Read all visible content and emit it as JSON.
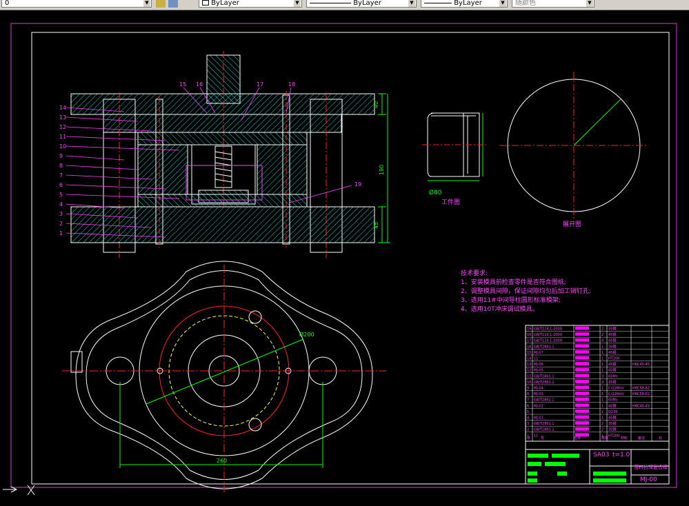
{
  "toolbar": {
    "layer_value": "0",
    "linetype_value": "ByLayer",
    "lineweight_value": "ByLayer",
    "linestyle_value": "ByLayer",
    "color_value": "随颜色"
  },
  "drawing": {
    "bom_numbers": [
      "14",
      "13",
      "12",
      "11",
      "10",
      "9",
      "8",
      "7",
      "6",
      "5",
      "4",
      "3",
      "2",
      "1"
    ],
    "upper_numbers": [
      "15",
      "16",
      "17",
      "18"
    ],
    "callout_19": "19",
    "dim_40": "40",
    "dim_190": "190",
    "dim_45": "45",
    "workpiece_label": "工件图",
    "blank_label": "展开图",
    "dim_260": "260",
    "dim_d200": "Ø200",
    "tech_title": "技术要求:",
    "tech_items": [
      "1、安装模具前检查零件是否符合图纸;",
      "2、调整模具间隙，保证间隙均匀后加工销钉孔;",
      "3、选用11#中间导柱圆形标准模架;",
      "4、选用10T冲床调试模具。"
    ],
    "title_material": "SA03",
    "title_thickness": "t=1.0",
    "title_name": "落料拉深复合模",
    "title_code": "MJ-00"
  },
  "bom": {
    "rows": [
      {
        "no": "19",
        "code": "GB/T119.1-2000",
        "qty": "2",
        "mat": "35钢",
        "note": ""
      },
      {
        "no": "18",
        "code": "GB/T119.1-2000",
        "qty": "2",
        "mat": "45钢",
        "note": ""
      },
      {
        "no": "17",
        "code": "GB/T119.1-2000",
        "qty": "4",
        "mat": "45钢",
        "note": ""
      },
      {
        "no": "16",
        "code": "GB/T2861.1",
        "qty": "1",
        "mat": "35钢",
        "note": ""
      },
      {
        "no": "15",
        "code": "MJ-07",
        "qty": "1",
        "mat": "45钢",
        "note": ""
      },
      {
        "no": "14",
        "code": "11",
        "qty": "1",
        "mat": "HT200",
        "note": ""
      },
      {
        "no": "13",
        "code": "MJ-06",
        "qty": "1",
        "mat": "45钢",
        "note": "HRC40-45"
      },
      {
        "no": "12",
        "code": "MJ-05",
        "qty": "1",
        "mat": "45钢",
        "note": ""
      },
      {
        "no": "11",
        "code": "GB/T2861.1",
        "qty": "3",
        "mat": "65Mn",
        "note": ""
      },
      {
        "no": "10",
        "code": "GB/T2861.1",
        "qty": "3",
        "mat": "35钢",
        "note": ""
      },
      {
        "no": "9",
        "code": "MJ-04",
        "qty": "1",
        "mat": "Cr12MoV",
        "note": "HRC58-62"
      },
      {
        "no": "8",
        "code": "MJ-03",
        "qty": "1",
        "mat": "Cr12MoV",
        "note": "HRC58-62"
      },
      {
        "no": "7",
        "code": "GB/T2861.1",
        "qty": "1",
        "mat": "65Mn",
        "note": ""
      },
      {
        "no": "6",
        "code": "MJ-02",
        "qty": "1",
        "mat": "45钢",
        "note": "HRC40-45"
      },
      {
        "no": "5",
        "code": "",
        "qty": "1",
        "mat": "Q235",
        "note": ""
      },
      {
        "no": "4",
        "code": "MJ-01",
        "qty": "1",
        "mat": "45钢",
        "note": ""
      },
      {
        "no": "3",
        "code": "GB/T2861.1",
        "qty": "2",
        "mat": "35钢",
        "note": ""
      },
      {
        "no": "2",
        "code": "GB/T2861.1",
        "qty": "2",
        "mat": "35钢",
        "note": ""
      },
      {
        "no": "1",
        "code": "11",
        "qty": "1",
        "mat": "HT200",
        "note": ""
      }
    ],
    "header": [
      "序",
      "号",
      "名称",
      "数量",
      "材料",
      "备注",
      "标"
    ]
  },
  "colors": {
    "frame": "#d040d0",
    "outline": "#ffffff",
    "hatch": "#00d8d8",
    "center": "#ff2020",
    "dim": "#00ff00",
    "hidden": "#ffff40",
    "label": "#ff40ff",
    "highlight": "#ff00ff"
  }
}
